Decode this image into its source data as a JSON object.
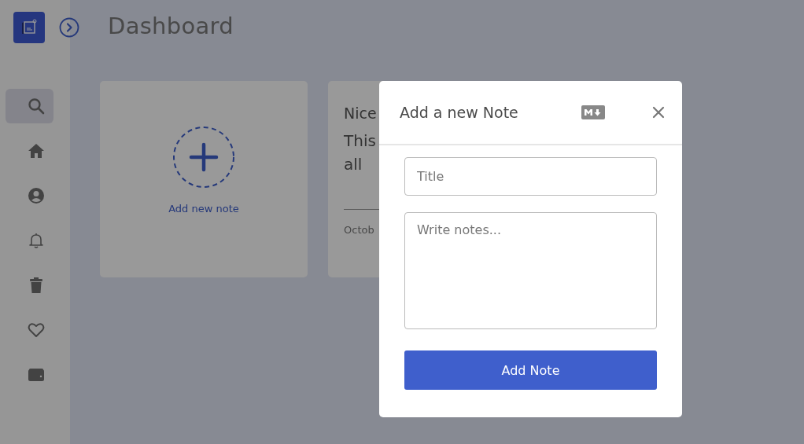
{
  "page": {
    "title": "Dashboard"
  },
  "sidebar": {
    "items": [
      {
        "kind": "search",
        "selected": true
      },
      {
        "kind": "home",
        "selected": false
      },
      {
        "kind": "profile",
        "selected": false
      },
      {
        "kind": "notifications",
        "selected": false
      },
      {
        "kind": "trash",
        "selected": false
      },
      {
        "kind": "favorites",
        "selected": false
      },
      {
        "kind": "wallet",
        "selected": false
      }
    ]
  },
  "cards": [
    {
      "kind": "add",
      "label": "Add new note"
    },
    {
      "kind": "note",
      "title": "Nice",
      "body": [
        "This",
        "all"
      ],
      "date": "Octob"
    }
  ],
  "modal": {
    "title": "Add a new Note",
    "title_placeholder": "Title",
    "notes_placeholder": "Write notes...",
    "button": "Add Note"
  }
}
